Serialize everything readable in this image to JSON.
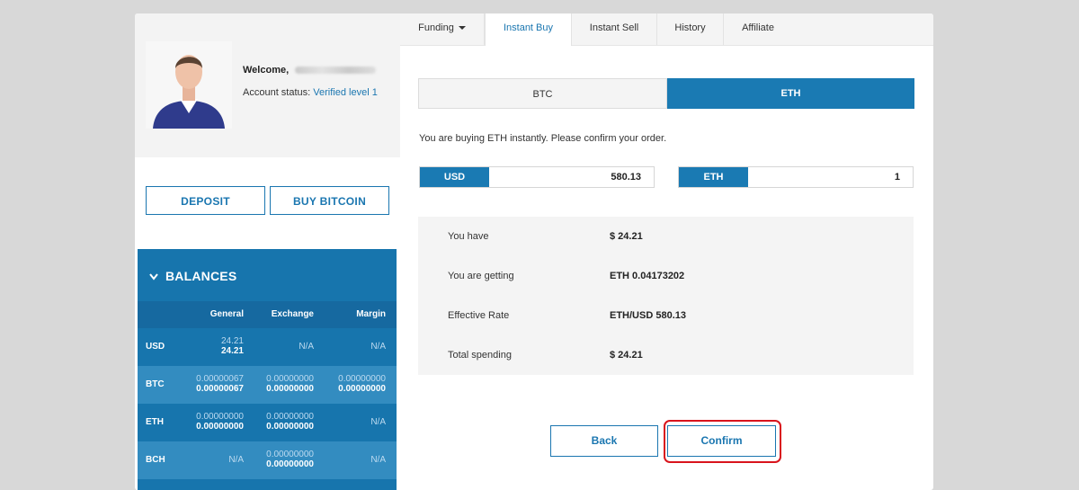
{
  "profile": {
    "welcome_label": "Welcome,",
    "status_label": "Account status:",
    "status_value": "Verified level 1"
  },
  "actions_left": {
    "deposit": "DEPOSIT",
    "buy_bitcoin": "BUY BITCOIN"
  },
  "balances": {
    "title": "BALANCES",
    "columns": [
      "General",
      "Exchange",
      "Margin"
    ],
    "rows": [
      {
        "currency": "USD",
        "general": [
          "24.21",
          "24.21"
        ],
        "exchange": "N/A",
        "margin": "N/A"
      },
      {
        "currency": "BTC",
        "general": [
          "0.00000067",
          "0.00000067"
        ],
        "exchange": [
          "0.00000000",
          "0.00000000"
        ],
        "margin": [
          "0.00000000",
          "0.00000000"
        ]
      },
      {
        "currency": "ETH",
        "general": [
          "0.00000000",
          "0.00000000"
        ],
        "exchange": [
          "0.00000000",
          "0.00000000"
        ],
        "margin": "N/A"
      },
      {
        "currency": "BCH",
        "general": "N/A",
        "exchange": [
          "0.00000000",
          "0.00000000"
        ],
        "margin": "N/A"
      }
    ]
  },
  "tabs": {
    "funding": "Funding",
    "instant_buy": "Instant Buy",
    "instant_sell": "Instant Sell",
    "history": "History",
    "affiliate": "Affiliate"
  },
  "toggle": {
    "btc": "BTC",
    "eth": "ETH",
    "selected": "ETH"
  },
  "note": "You are buying ETH instantly. Please confirm your order.",
  "amounts": {
    "fiat_label": "USD",
    "fiat_value": "580.13",
    "crypto_label": "ETH",
    "crypto_value": "1"
  },
  "summary": [
    {
      "label": "You have",
      "value": "$ 24.21"
    },
    {
      "label": "You are getting",
      "value": "ETH 0.04173202"
    },
    {
      "label": "Effective Rate",
      "value": "ETH/USD 580.13"
    },
    {
      "label": "Total spending",
      "value": "$ 24.21"
    }
  ],
  "buttons": {
    "back": "Back",
    "confirm": "Confirm"
  },
  "colors": {
    "accent": "#1a76b0",
    "balances_bg": "#1775ad",
    "highlight": "#d9141c"
  }
}
